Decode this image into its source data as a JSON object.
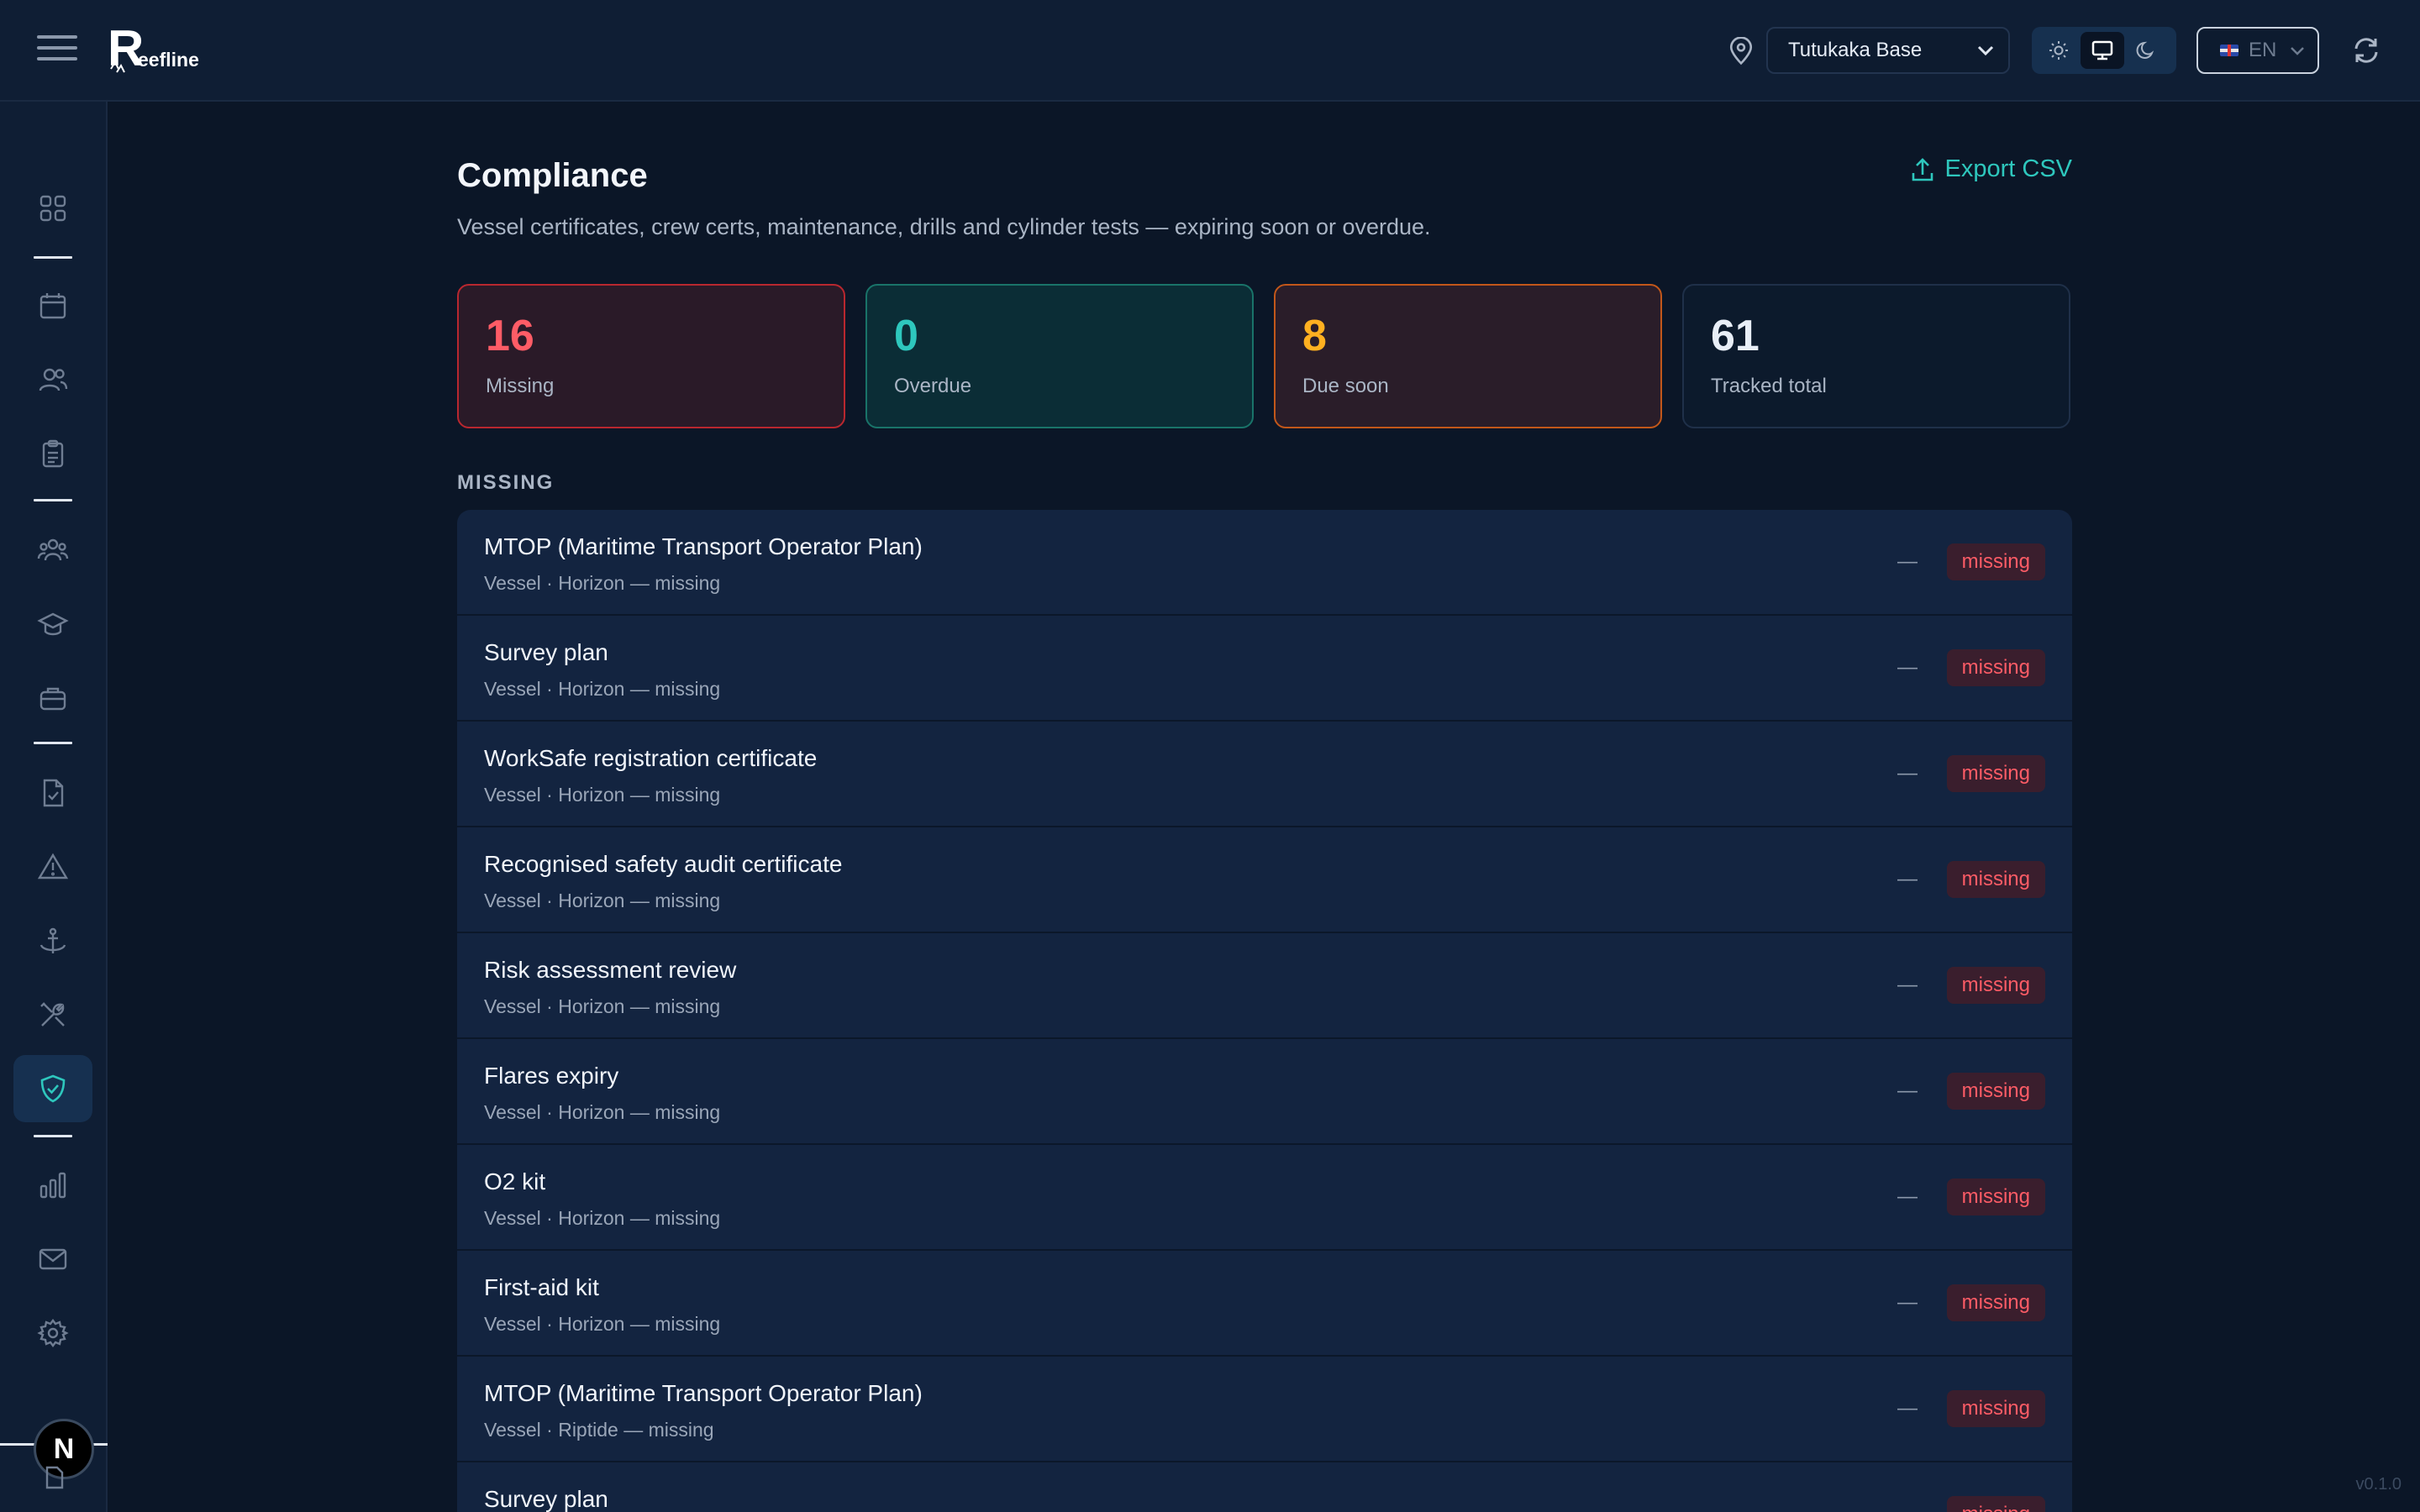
{
  "app": {
    "name": "Reefline",
    "logo_letter": "R",
    "logo_rest": "eefline",
    "version": "v0.1.0",
    "n_badge": "N"
  },
  "header": {
    "location": "Tutukaka Base",
    "language": "EN",
    "theme_options": [
      "light",
      "system",
      "dark"
    ],
    "theme_active": "system"
  },
  "sidebar": {
    "items": [
      {
        "icon": "dashboard-grid-icon"
      },
      {
        "icon": "calendar-icon"
      },
      {
        "icon": "people-icon"
      },
      {
        "icon": "clipboard-icon"
      },
      {
        "icon": "team-icon"
      },
      {
        "icon": "graduation-cap-icon"
      },
      {
        "icon": "briefcase-icon"
      },
      {
        "icon": "file-check-icon"
      },
      {
        "icon": "warning-triangle-icon"
      },
      {
        "icon": "anchor-icon"
      },
      {
        "icon": "tools-icon"
      },
      {
        "icon": "shield-check-icon",
        "active": true
      },
      {
        "icon": "bar-chart-icon"
      },
      {
        "icon": "mail-icon"
      },
      {
        "icon": "settings-gear-icon"
      }
    ]
  },
  "page": {
    "title": "Compliance",
    "subtitle": "Vessel certificates, crew certs, maintenance, drills and cylinder tests — expiring soon or overdue.",
    "export_label": "Export CSV"
  },
  "stats": {
    "missing": {
      "value": "16",
      "label": "Missing",
      "color": "#ff5c66"
    },
    "overdue": {
      "value": "0",
      "label": "Overdue",
      "color": "#2ec7bd"
    },
    "due_soon": {
      "value": "8",
      "label": "Due soon",
      "color": "#ffb020"
    },
    "total": {
      "value": "61",
      "label": "Tracked total",
      "color": "#e8eef7"
    }
  },
  "section": {
    "label": "MISSING"
  },
  "rows": [
    {
      "title": "MTOP (Maritime Transport Operator Plan)",
      "sub": "Vessel · Horizon — missing",
      "due": "—",
      "status": "missing"
    },
    {
      "title": "Survey plan",
      "sub": "Vessel · Horizon — missing",
      "due": "—",
      "status": "missing"
    },
    {
      "title": "WorkSafe registration certificate",
      "sub": "Vessel · Horizon — missing",
      "due": "—",
      "status": "missing"
    },
    {
      "title": "Recognised safety audit certificate",
      "sub": "Vessel · Horizon — missing",
      "due": "—",
      "status": "missing"
    },
    {
      "title": "Risk assessment review",
      "sub": "Vessel · Horizon — missing",
      "due": "—",
      "status": "missing"
    },
    {
      "title": "Flares expiry",
      "sub": "Vessel · Horizon — missing",
      "due": "—",
      "status": "missing"
    },
    {
      "title": "O2 kit",
      "sub": "Vessel · Horizon — missing",
      "due": "—",
      "status": "missing"
    },
    {
      "title": "First-aid kit",
      "sub": "Vessel · Horizon — missing",
      "due": "—",
      "status": "missing"
    },
    {
      "title": "MTOP (Maritime Transport Operator Plan)",
      "sub": "Vessel · Riptide — missing",
      "due": "—",
      "status": "missing"
    },
    {
      "title": "Survey plan",
      "sub": "",
      "due": "",
      "status": "missing"
    }
  ]
}
